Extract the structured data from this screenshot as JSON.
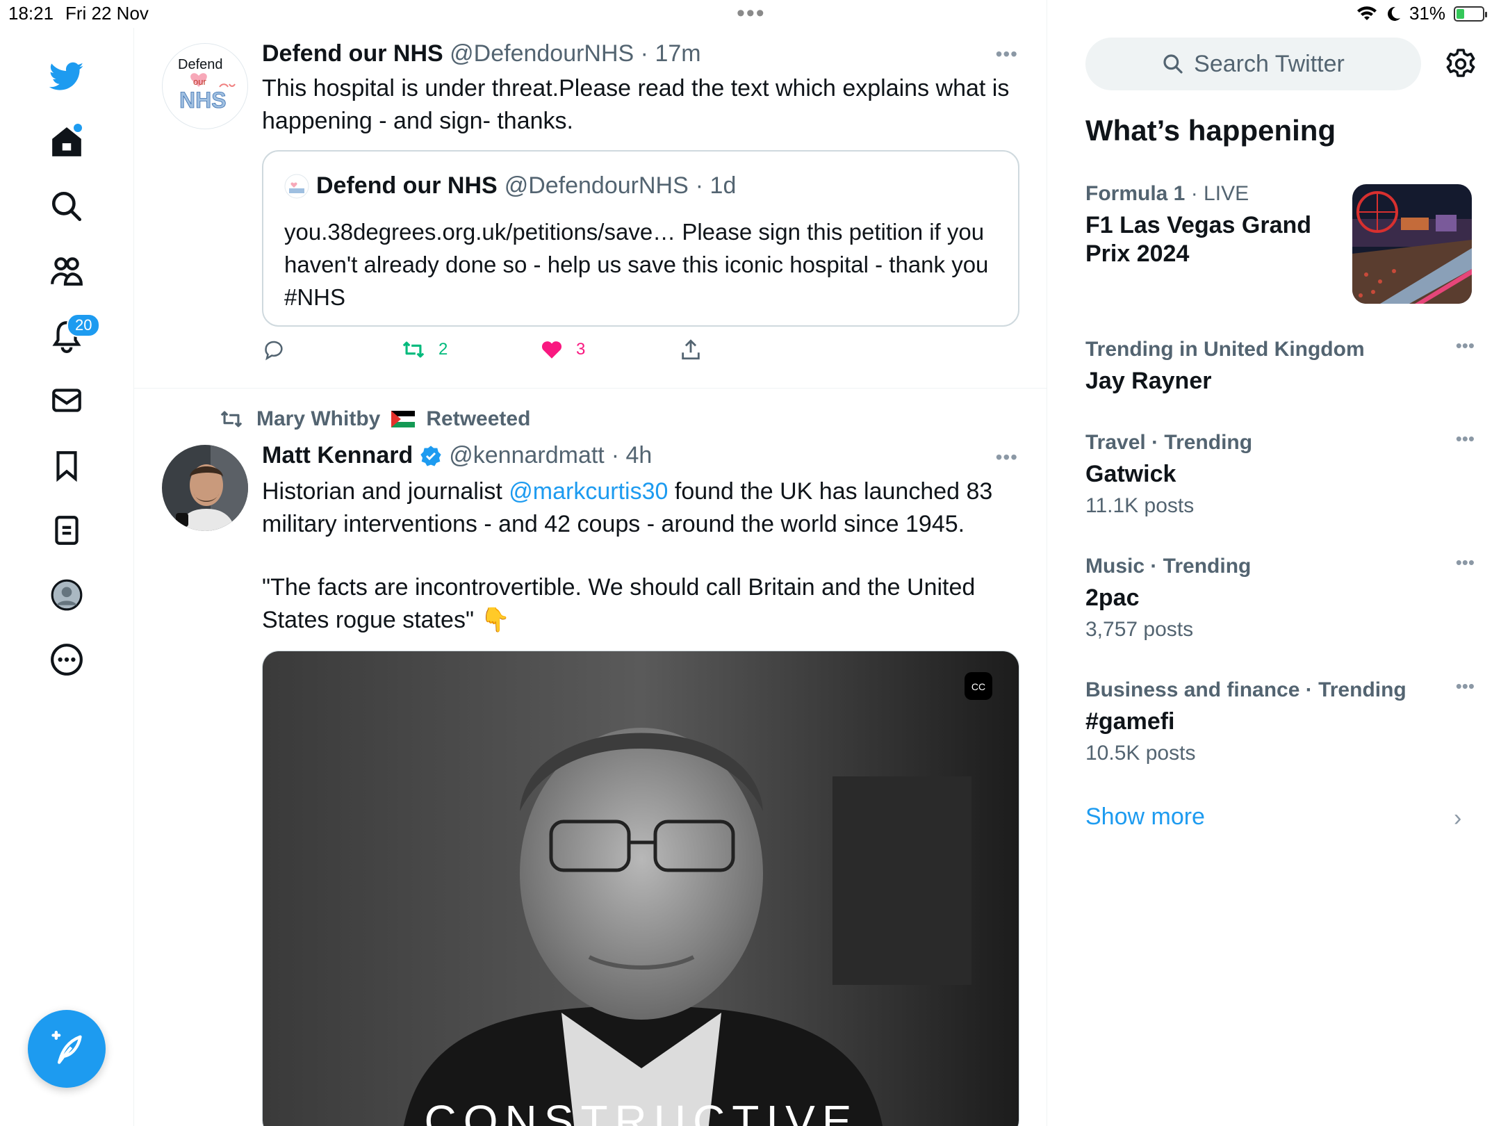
{
  "status_bar": {
    "time": "18:21",
    "date": "Fri 22 Nov",
    "battery": "31%",
    "battery_level": 0.31
  },
  "nav": {
    "notifications_badge": "20",
    "icons": [
      "twitter-logo-icon",
      "home-icon",
      "search-icon",
      "communities-icon",
      "bell-icon",
      "mail-icon",
      "bookmark-icon",
      "lists-icon",
      "profile-icon",
      "more-icon",
      "compose-icon"
    ]
  },
  "feed": {
    "tweet1": {
      "name": "Defend our NHS",
      "handle": "@DefendourNHS",
      "time": "· 17m",
      "avatar_text_1": "Defend",
      "avatar_text_2": "our",
      "avatar_text_3": "NHS",
      "body": "This hospital is under threat.Please read the text which explains what is happening - and sign- thanks.",
      "quote": {
        "name": "Defend our NHS",
        "handle": "@DefendourNHS",
        "time": "· 1d",
        "body": "you.38degrees.org.uk/petitions/save… Please sign this petition if you haven't already done so - help us save this iconic hospital - thank you #NHS"
      },
      "retweets": "2",
      "likes": "3"
    },
    "tweet2": {
      "retweeted_by": "Mary Whitby",
      "retweeted_label": "Retweeted",
      "name": "Matt Kennard",
      "handle": "@kennardmatt",
      "time": "· 4h",
      "body_pre": "Historian and journalist ",
      "mention": "@markcurtis30",
      "body_post": " found the UK has launched 83 military interventions - and 42 coups - around the world since 1945.",
      "quote_text": "\"The facts are incontrovertible. We should call Britain and the United States rogue states\" 👇",
      "video_caption": "CONSTRUCTIVE"
    }
  },
  "sidebar": {
    "search_placeholder": "Search Twitter",
    "whats_happening": "What’s happening",
    "trends": [
      {
        "meta": "Formula 1",
        "meta_extra": "· LIVE",
        "name": "F1 Las Vegas Grand Prix 2024",
        "count": ""
      },
      {
        "meta": "Trending in United Kingdom",
        "meta_extra": "",
        "name": "Jay Rayner",
        "count": ""
      },
      {
        "meta": "Travel · Trending",
        "meta_extra": "",
        "name": "Gatwick",
        "count": "11.1K posts"
      },
      {
        "meta": "Music · Trending",
        "meta_extra": "",
        "name": "2pac",
        "count": "3,757 posts"
      },
      {
        "meta": "Business and finance · Trending",
        "meta_extra": "",
        "name": "#gamefi",
        "count": "10.5K posts"
      }
    ],
    "show_more": "Show more"
  },
  "colors": {
    "accent": "#1d9bf0",
    "retweet_green": "#00ba7c",
    "like_pink": "#f91880"
  }
}
